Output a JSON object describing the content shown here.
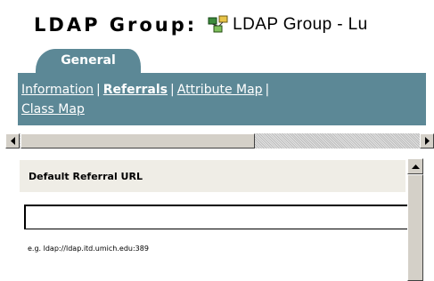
{
  "header": {
    "label": "LDAP Group:",
    "object_name": "LDAP Group - Lu",
    "object_icon": "ldap-group-icon"
  },
  "tabs": [
    {
      "label": "General",
      "active": true
    }
  ],
  "links": [
    {
      "label": "Information",
      "active": false
    },
    {
      "label": "Referrals",
      "active": true
    },
    {
      "label": "Attribute Map",
      "active": false
    },
    {
      "label": "Class Map",
      "active": false
    }
  ],
  "link_separator": "|",
  "section": {
    "title": "Default Referral URL"
  },
  "referral_input": {
    "value": "",
    "hint": "e.g. ldap://ldap.itd.umich.edu:389"
  },
  "colors": {
    "accent": "#5c8896",
    "section_bg": "#efede6"
  }
}
